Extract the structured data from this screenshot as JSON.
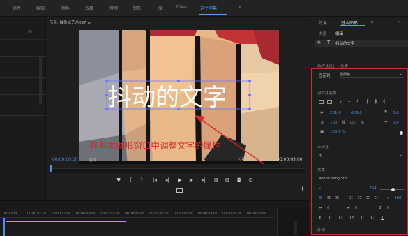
{
  "top_nav": {
    "items": [
      "组件",
      "编辑",
      "颜色",
      "效果",
      "音频",
      "图形",
      "库",
      "Titles",
      "这个字幕",
      "»"
    ],
    "active_index": 8,
    "active_color": "#5d9be8"
  },
  "left_panel": {
    "ruler_value": "00"
  },
  "program_monitor": {
    "title": "节目: 抽象派艺术097 ≡",
    "title_text": "抖动的文字",
    "annotation": "在基本图形窗口中调整文字的属性",
    "annotation_color": "#d92727",
    "timecode_in": "00:00:00:00",
    "fit_label": "适合",
    "resolution": "1/2",
    "timecode_out": "00:00:05:00",
    "scrub_progress": 0.0
  },
  "transport": {
    "buttons": [
      "marker-icon",
      "in-point-icon",
      "out-point-icon",
      "go-to-in-icon",
      "step-back-icon",
      "play-icon",
      "step-forward-icon",
      "go-to-out-icon",
      "insert-icon",
      "overwrite-icon",
      "export-frame-icon",
      "compare-icon"
    ],
    "glyphs": [
      "♥",
      "{",
      "}",
      "|◂",
      "◂|",
      "▶",
      "|▸",
      "▸|",
      "⊞",
      "⊟",
      "◘",
      "⊡"
    ],
    "add_label": "+"
  },
  "right_panel": {
    "tabs": [
      "效果",
      "基本图形",
      "≡",
      "»"
    ],
    "active_tab_index": 1,
    "subtabs": [
      "浏览",
      "编辑"
    ],
    "layer_icon": "T",
    "layer_name": "抖动的文字",
    "responsive_section": "响应式设计 - 位置",
    "pin_to_label": "固定到:",
    "pin_to_value": "视频帧",
    "align_section": "对齐并变换",
    "position_x": "281.6",
    "position_y": "603.0",
    "rotation": "0.0",
    "anchor": "0.0",
    "scale": "100",
    "scale_2": "100",
    "scale_unit": "%",
    "opacity": "100.0 %",
    "opacity_value": 100,
    "master_style_section": "主样式",
    "master_style_value": "无",
    "text_section": "文本",
    "font": "Adobe Song Std",
    "font_style": "L",
    "font_size": "264",
    "tracking": "0",
    "kerning": "0",
    "leading": "0",
    "baseline": "400",
    "text_style_buttons": [
      "T",
      "T",
      "TT",
      "Tт",
      "T'",
      "T,"
    ],
    "appearance_section": "外观",
    "highlight_color": "#c9302c"
  },
  "timeline": {
    "ruler_labels": [
      "00:00:00",
      "00:00:01:00",
      "00:00:02:00",
      "00:00:03:00",
      "00:00:04:00",
      "00:00:05:00",
      "00:00:06:00",
      "00:00:07:00",
      "00:00:08:00",
      "00:00:09:00",
      "00:00:10:00"
    ],
    "clip_color": "#c6a730"
  }
}
